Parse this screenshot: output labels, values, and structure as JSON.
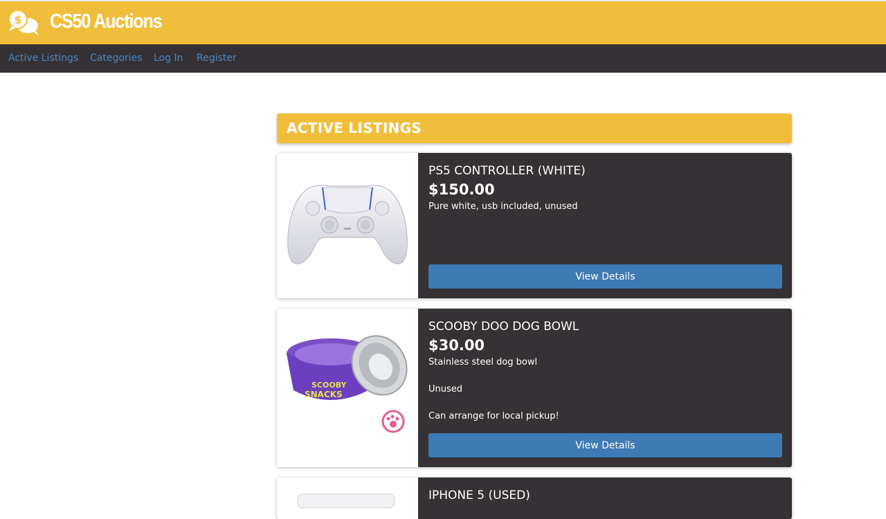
{
  "header": {
    "brand": "CS50 Auctions",
    "logo_icon": "speech-bubbles-dollar-icon",
    "brand_color": "#f0be3a"
  },
  "nav": {
    "items": [
      {
        "label": "Active Listings"
      },
      {
        "label": "Categories"
      },
      {
        "label": "Log In"
      },
      {
        "label": "Register"
      }
    ],
    "link_color": "#4b86c6",
    "background": "#363134"
  },
  "main": {
    "heading": "ACTIVE LISTINGS",
    "listings": [
      {
        "title": "PS5 CONTROLLER (WHITE)",
        "price": "$150.00",
        "description": [
          "Pure white, usb included, unused"
        ],
        "button_label": "View Details",
        "image_icon": "game-controller-icon"
      },
      {
        "title": "SCOOBY DOO DOG BOWL",
        "price": "$30.00",
        "description": [
          "Stainless steel dog bowl",
          "Unused",
          "Can arrange for local pickup!"
        ],
        "button_label": "View Details",
        "image_icon": "dog-bowl-icon"
      },
      {
        "title": "IPHONE 5 (USED)",
        "image_icon": "phone-icon"
      }
    ],
    "button_color": "#3e7ab6"
  }
}
